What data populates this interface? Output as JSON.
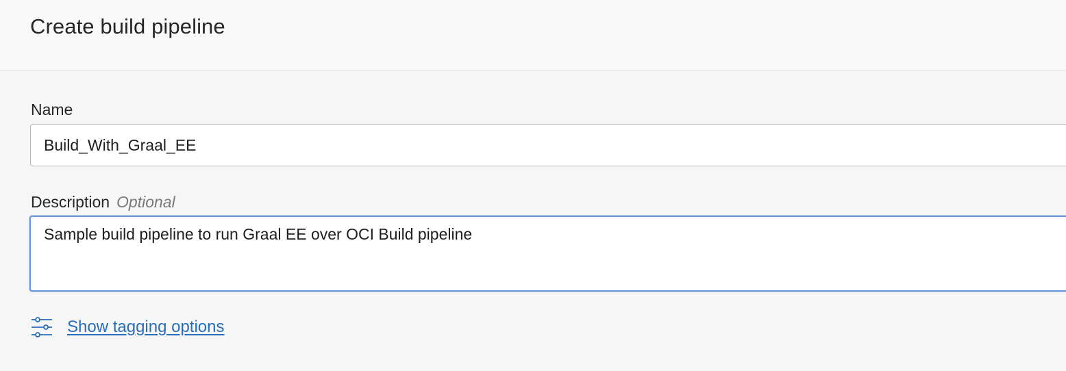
{
  "header": {
    "title": "Create build pipeline"
  },
  "form": {
    "name": {
      "label": "Name",
      "value": "Build_With_Graal_EE"
    },
    "description": {
      "label": "Description",
      "optional_label": "Optional",
      "value": "Sample build pipeline to run Graal EE over OCI Build pipeline"
    },
    "tagging": {
      "icon": "sliders-icon",
      "link_label": "Show tagging options"
    }
  },
  "colors": {
    "link": "#2a6ebb",
    "focus_border": "#6e9ad4",
    "background": "#f6f6f6"
  }
}
